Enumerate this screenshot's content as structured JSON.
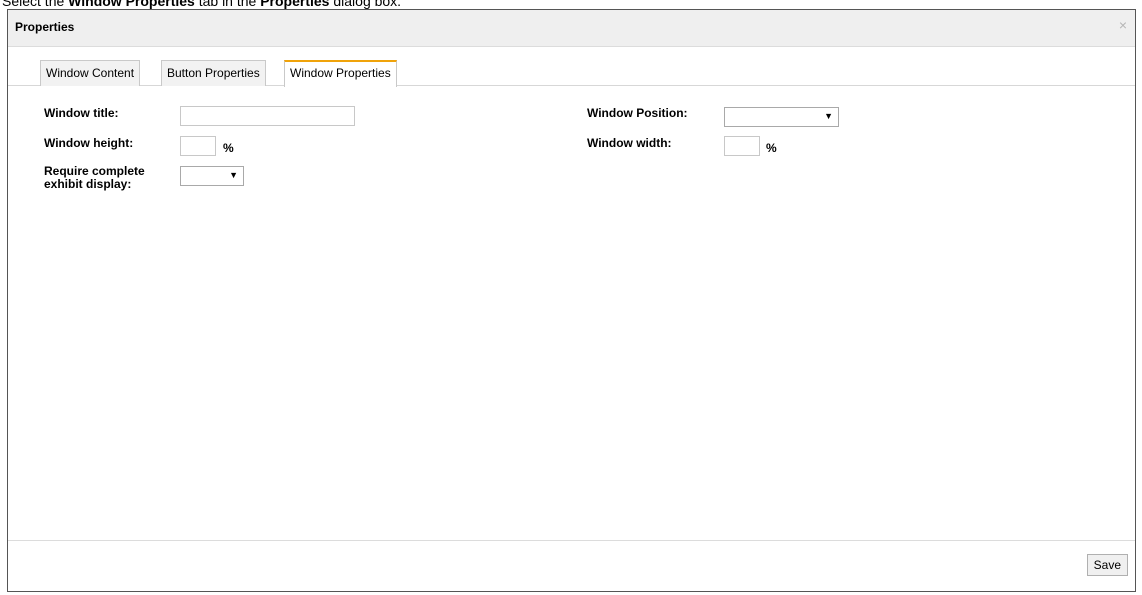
{
  "instruction": {
    "prefix": "Select the ",
    "tab_name": "Window Properties",
    "middle": " tab in the ",
    "dialog_name": "Properties",
    "suffix": " dialog box."
  },
  "dialog": {
    "title": "Properties",
    "close_label": "×",
    "tabs": [
      {
        "label": "Window Content",
        "active": false
      },
      {
        "label": "Button Properties",
        "active": false
      },
      {
        "label": "Window Properties",
        "active": true
      }
    ],
    "form": {
      "window_title_label": "Window title:",
      "window_title_value": "",
      "window_height_label": "Window height:",
      "window_height_value": "",
      "window_height_unit": "%",
      "require_display_label_line1": "Require complete",
      "require_display_label_line2": "exhibit display:",
      "require_display_value": "",
      "window_position_label": "Window Position:",
      "window_position_value": "",
      "window_width_label": "Window width:",
      "window_width_value": "",
      "window_width_unit": "%",
      "dropdown_arrow": "▼"
    },
    "save_label": "Save"
  },
  "colors": {
    "active_tab_accent": "#f0a30a",
    "titlebar_bg": "#efefef"
  }
}
